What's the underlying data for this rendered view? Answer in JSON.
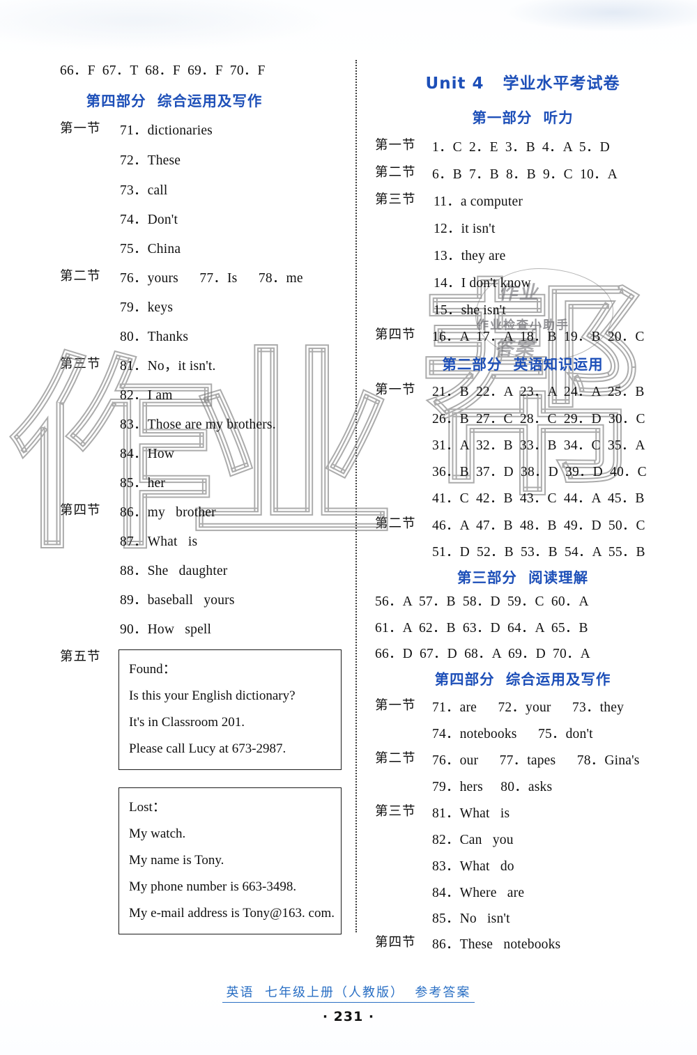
{
  "document": {
    "footer_title": "英语  七年级上册（人教版）  参考答案",
    "page_number": "· 231 ·"
  },
  "watermark": {
    "big_chars": [
      "作",
      "业",
      "帮"
    ],
    "logo_text": "作业检查小助手",
    "logo_mark_top": "作业",
    "logo_mark_bottom": "答案"
  },
  "left_column": {
    "top_answers": "66．F  67．T  68．F  69．F  70．F",
    "heading_part4": "第四部分  综合运用及写作",
    "sections": {
      "s1_label": "第一节",
      "s1_items": [
        "71．dictionaries",
        "72．These",
        "73．call",
        "74．Don't",
        "75．China"
      ],
      "s2_label": "第二节",
      "s2_items": [
        "76．yours      77．Is      78．me",
        "79．keys",
        "80．Thanks"
      ],
      "s3_label": "第三节",
      "s3_items": [
        "81．No，it isn't.",
        "82．I am",
        "83．Those are my brothers.",
        "84．How",
        "85．her"
      ],
      "s4_label": "第四节",
      "s4_items": [
        "86．my   brother",
        "87．What   is",
        "88．She   daughter",
        "89．baseball   yours",
        "90．How   spell"
      ],
      "s5_label": "第五节"
    },
    "box_found": {
      "lines": [
        "Found：",
        "Is this your English dictionary?",
        "It's in Classroom 201.",
        "Please call Lucy at 673-2987."
      ]
    },
    "box_lost": {
      "lines": [
        "Lost：",
        "My watch.",
        "My name is Tony.",
        "My phone number is 663-3498.",
        "My e-mail address is Tony@163. com."
      ]
    }
  },
  "right_column": {
    "unit_title": "Unit 4   学业水平考试卷",
    "heading_part1": "第一部分  听力",
    "p1": {
      "s1_label": "第一节",
      "s1_answers": "1．C  2．E  3．B  4．A  5．D",
      "s2_label": "第二节",
      "s2_answers": "6．B  7．B  8．B  9．C  10．A",
      "s3_label": "第三节",
      "s3_items": [
        "11．a computer",
        "12．it isn't",
        "13．they are",
        "14．I don't know",
        "15．she isn't"
      ],
      "s4_label": "第四节",
      "s4_answers": "16．A  17．A  18．B  19．B  20．C"
    },
    "heading_part2": "第二部分  英语知识运用",
    "p2": {
      "s1_label": "第一节",
      "s1_rows": [
        "21．B  22．A  23．A  24．A  25．B",
        "26．B  27．C  28．C  29．D  30．C",
        "31．A  32．B  33．B  34．C  35．A",
        "36．B  37．D  38．D  39．D  40．C",
        "41．C  42．B  43．C  44．A  45．B"
      ],
      "s2_label": "第二节",
      "s2_rows": [
        "46．A  47．B  48．B  49．D  50．C",
        "51．D  52．B  53．B  54．A  55．B"
      ]
    },
    "heading_part3": "第三部分  阅读理解",
    "p3_rows": [
      "56．A  57．B  58．D  59．C  60．A",
      "61．A  62．B  63．D  64．A  65．B",
      "66．D  67．D  68．A  69．D  70．A"
    ],
    "heading_part4": "第四部分  综合运用及写作",
    "p4": {
      "s1_label": "第一节",
      "s1_rows": [
        "71．are      72．your      73．they",
        "74．notebooks      75．don't"
      ],
      "s2_label": "第二节",
      "s2_rows": [
        "76．our      77．tapes      78．Gina's",
        "79．hers     80．asks"
      ],
      "s3_label": "第三节",
      "s3_rows": [
        "81．What   is",
        "82．Can   you",
        "83．What   do",
        "84．Where   are",
        "85．No   isn't"
      ],
      "s4_label": "第四节",
      "s4_rows": [
        "86．These   notebooks"
      ]
    }
  }
}
